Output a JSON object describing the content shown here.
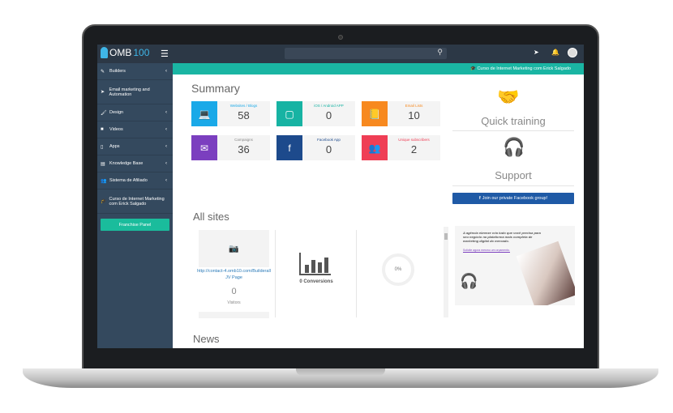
{
  "app": {
    "logo_prefix": "OMB",
    "logo_suffix": "100"
  },
  "sidebar": {
    "items": [
      {
        "label": "Builders",
        "icon": "pencil-icon"
      },
      {
        "label": "Email marketing and Automation",
        "icon": "send-icon"
      },
      {
        "label": "Design",
        "icon": "brush-icon"
      },
      {
        "label": "Videos",
        "icon": "video-icon"
      },
      {
        "label": "Apps",
        "icon": "tablet-icon"
      },
      {
        "label": "Knowledge Base",
        "icon": "book-icon"
      },
      {
        "label": "Sistema de Afiliado",
        "icon": "users-icon"
      },
      {
        "label": "Curso de Internet Marketing com Erick Salgado",
        "icon": "graduation-cap-icon"
      }
    ],
    "franchise_button": "Franchise Panel"
  },
  "banner": "🎓 Curso de Internet Marketing com Erick Salgado",
  "summary": {
    "title": "Summary",
    "cards": [
      {
        "label": "Websites / Blogs",
        "value": "58",
        "color": "#1aa9e8",
        "label_color": "#1aa9e8",
        "icon": "💻"
      },
      {
        "label": "iOS / Android APP",
        "value": "0",
        "color": "#17b3a3",
        "label_color": "#17b3a3",
        "icon": "▢"
      },
      {
        "label": "Email Lists",
        "value": "10",
        "color": "#f7891f",
        "label_color": "#f7891f",
        "icon": "📒"
      },
      {
        "label": "Campaigns",
        "value": "36",
        "color": "#7b3fbf",
        "label_color": "#888",
        "icon": "✉"
      },
      {
        "label": "Facebook App",
        "value": "0",
        "color": "#1d4a8c",
        "label_color": "#1d4a8c",
        "icon": "f"
      },
      {
        "label": "Unique subscribers",
        "value": "2",
        "color": "#ef3e55",
        "label_color": "#ef3e55",
        "icon": "👥"
      }
    ]
  },
  "right": {
    "quick_training": "Quick training",
    "support": "Support",
    "facebook_button": "Join our private Facebook group!"
  },
  "all_sites": {
    "title": "All sites",
    "site_url": "http://contact-4.omb10.com/Builderall JV Page",
    "visitors": "0",
    "visitors_label": "Visitors",
    "conversions": "0 Conversions",
    "percent": "0%"
  },
  "ad": {
    "headline": "A agência ebreeze cria tudo que você precisa para seu negócio na plataforma mais completa de marketing digital do mercado.",
    "link": "Solicite agora mesmo um orçamento."
  },
  "news": {
    "title": "News"
  }
}
